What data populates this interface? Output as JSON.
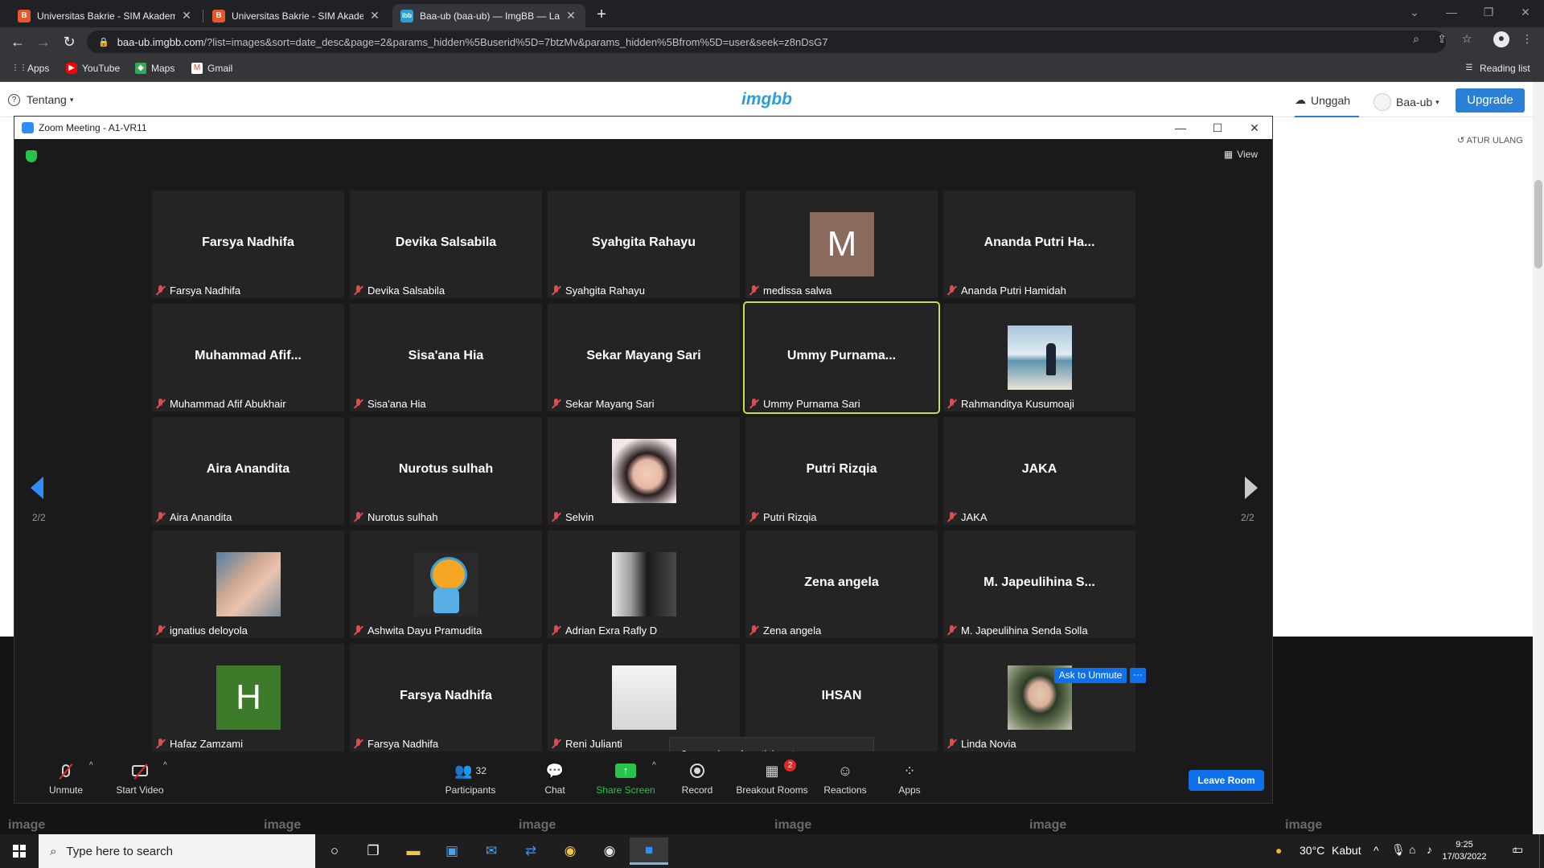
{
  "browser": {
    "tabs": [
      {
        "title": "Universitas Bakrie - SIM Akademik",
        "favicon": "B",
        "color": "#e8562a"
      },
      {
        "title": "Universitas Bakrie - SIM Akademik",
        "favicon": "B",
        "color": "#e8562a"
      },
      {
        "title": "Baa-ub (baa-ub) — ImgBB — Latest",
        "favicon": "ibb",
        "color": "#2a9fd6"
      }
    ],
    "url_domain": "baa-ub.imgbb.com",
    "url_path": "/?list=images&sort=date_desc&page=2&params_hidden%5Buserid%5D=7btzMv&params_hidden%5Bfrom%5D=user&seek=z8nDsG7",
    "bookmarks": [
      "Apps",
      "YouTube",
      "Maps",
      "Gmail"
    ],
    "reading_list": "Reading list"
  },
  "site": {
    "tentang": "Tentang",
    "logo": "imgbb",
    "unggah": "Unggah",
    "user": "Baa-ub",
    "upgrade": "Upgrade",
    "atur_ulang": "ATUR ULANG",
    "thumb_label": "image"
  },
  "zoom": {
    "window_title": "Zoom Meeting - A1-VR11",
    "view_label": "View",
    "page_indicator": "2/2",
    "ask_to_unmute": "Ask to Unmute",
    "more": "···",
    "unassigned_tip": "2 unassigned participants",
    "participants": [
      {
        "display": "Farsya Nadhifa",
        "name": "Farsya Nadhifa"
      },
      {
        "display": "Devika Salsabila",
        "name": "Devika Salsabila"
      },
      {
        "display": "Syahgita Rahayu",
        "name": "Syahgita Rahayu"
      },
      {
        "display": "",
        "name": "medissa salwa",
        "avatar": "letter",
        "letter": "M",
        "avatar_color": "#8b6a5e"
      },
      {
        "display": "Ananda Putri Ha...",
        "name": "Ananda Putri Hamidah"
      },
      {
        "display": "Muhammad  Afif...",
        "name": "Muhammad Afif Abukhair"
      },
      {
        "display": "Sisa'ana Hia",
        "name": "Sisa'ana Hia"
      },
      {
        "display": "Sekar Mayang Sari",
        "name": "Sekar Mayang Sari"
      },
      {
        "display": "Ummy  Purnama...",
        "name": "Ummy Purnama Sari",
        "active": true
      },
      {
        "display": "",
        "name": "Rahmanditya Kusumoaji",
        "avatar": "photo-sea"
      },
      {
        "display": "Aira Anandita",
        "name": "Aira Anandita"
      },
      {
        "display": "Nurotus sulhah",
        "name": "Nurotus sulhah"
      },
      {
        "display": "",
        "name": "Selvin",
        "avatar": "photo-girl"
      },
      {
        "display": "Putri Rizqia",
        "name": "Putri Rizqia"
      },
      {
        "display": "JAKA",
        "name": "JAKA"
      },
      {
        "display": "",
        "name": "ignatius deloyola",
        "avatar": "photo-baby"
      },
      {
        "display": "",
        "name": "Ashwita Dayu Pramudita",
        "avatar": "photo-ryan"
      },
      {
        "display": "",
        "name": "Adrian Exra Rafly D",
        "avatar": "photo-bw"
      },
      {
        "display": "Zena angela",
        "name": "Zena angela"
      },
      {
        "display": "M. Japeulihina S...",
        "name": "M. Japeulihina Senda Solla"
      },
      {
        "display": "",
        "name": "Hafaz Zamzami",
        "avatar": "letter",
        "letter": "H",
        "avatar_color": "#3d7a2a"
      },
      {
        "display": "Farsya Nadhifa",
        "name": "Farsya Nadhifa"
      },
      {
        "display": "",
        "name": "Reni Julianti",
        "avatar": "photo-blank"
      },
      {
        "display": "IHSAN",
        "name": ""
      },
      {
        "display": "",
        "name": "Linda Novia",
        "avatar": "photo-hijab"
      }
    ],
    "toolbar": {
      "unmute": "Unmute",
      "start_video": "Start Video",
      "participants": "Participants",
      "participant_count": "32",
      "chat": "Chat",
      "share_screen": "Share Screen",
      "record": "Record",
      "breakout_rooms": "Breakout Rooms",
      "breakout_badge": "2",
      "reactions": "Reactions",
      "apps": "Apps",
      "leave_room": "Leave Room"
    }
  },
  "taskbar": {
    "search_placeholder": "Type here to search",
    "weather_temp": "30°C",
    "weather_text": "Kabut",
    "time": "9:25",
    "date": "17/03/2022",
    "notification_count": "1"
  }
}
